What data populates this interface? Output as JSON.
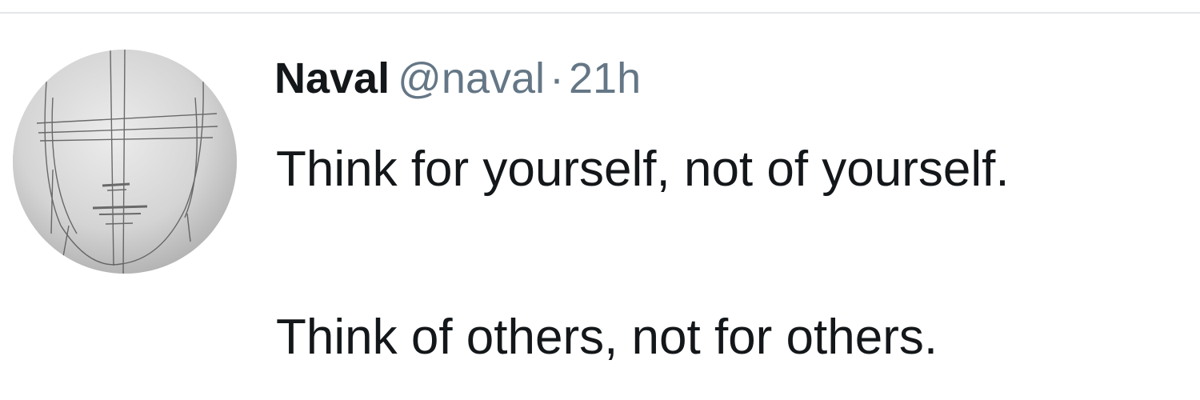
{
  "tweet": {
    "author": {
      "name": "Naval",
      "handle": "@naval",
      "avatar_icon": "sketched-face-avatar"
    },
    "separator": "·",
    "timestamp": "21h",
    "text_lines": [
      "Think for yourself, not of yourself.",
      "Think of others, not for others."
    ]
  },
  "colors": {
    "background": "#ffffff",
    "name_text": "#14171a",
    "secondary_text": "#657786",
    "divider": "#e3e6e9"
  }
}
